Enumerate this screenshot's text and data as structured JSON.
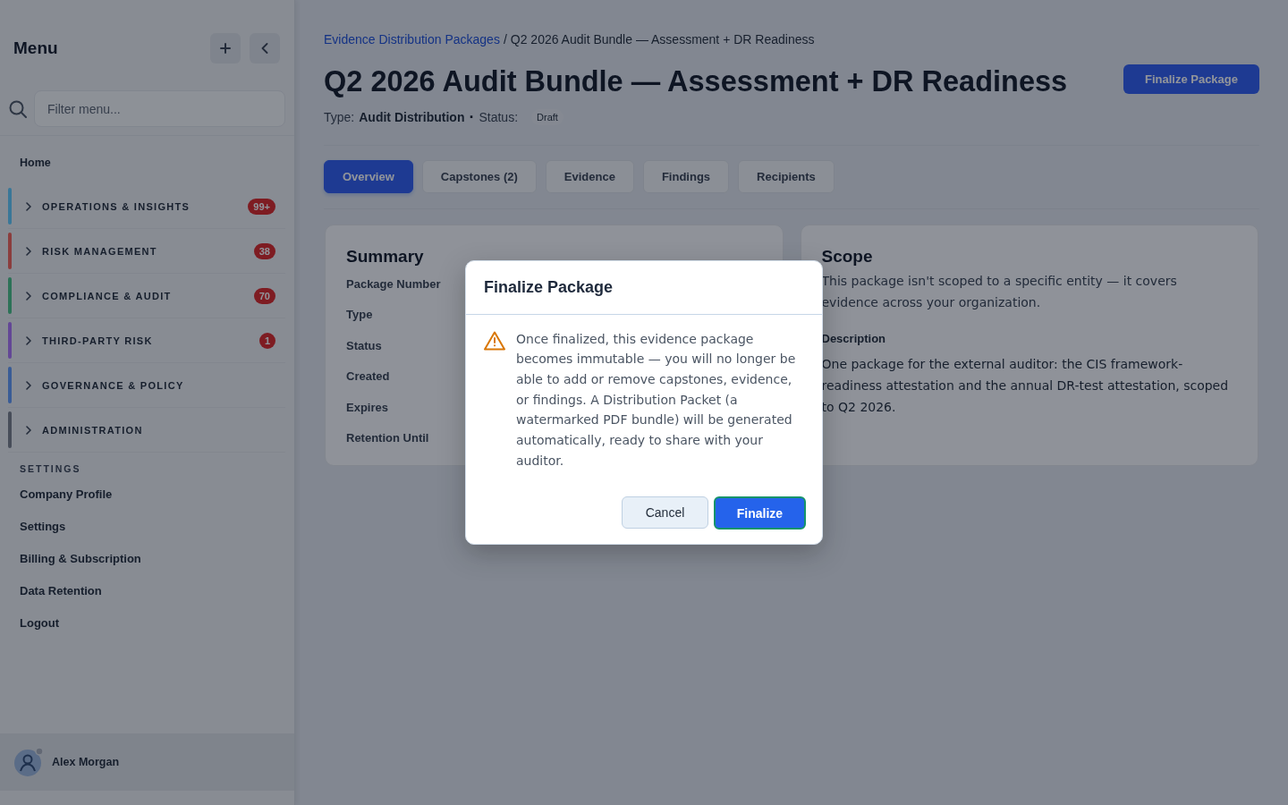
{
  "sidebar": {
    "title": "Menu",
    "filter": {
      "placeholder": "Filter menu..."
    },
    "home": "Home",
    "groups": [
      {
        "label": "OPERATIONS & INSIGHTS",
        "color": "#3a7899",
        "badge": "99+",
        "expanded": false
      },
      {
        "label": "RISK MANAGEMENT",
        "color": "#8c3e3e",
        "badge": "38",
        "expanded": false
      },
      {
        "label": "COMPLIANCE & AUDIT",
        "color": "#2d7358",
        "badge": "70",
        "expanded": false
      },
      {
        "label": "THIRD-PARTY RISK",
        "color": "#644896",
        "badge": "1",
        "expanded": false
      },
      {
        "label": "GOVERNANCE & POLICY",
        "color": "#3a5c96",
        "expanded": false
      },
      {
        "label": "ADMINISTRATION",
        "color": "#484e5a",
        "expanded": false
      }
    ],
    "settings_heading": "SETTINGS",
    "settings_items": [
      "Company Profile",
      "Settings",
      "Billing & Subscription",
      "Data Retention",
      "Logout"
    ],
    "user": {
      "name": "Alex Morgan"
    }
  },
  "breadcrumb": {
    "link": "Evidence Distribution Packages",
    "separator": "/",
    "current": "Q2 2026 Audit Bundle — Assessment + DR Readiness"
  },
  "page": {
    "title": "Q2 2026 Audit Bundle — Assessment + DR Readiness",
    "action": "Finalize Package",
    "meta": {
      "type_label": "Type:",
      "type_value": "Audit Distribution",
      "separator": "·",
      "status_label": "Status:",
      "status_value": "Draft"
    }
  },
  "tabs": [
    {
      "label": "Overview",
      "selected": true
    },
    {
      "label": "Capstones (2)",
      "selected": false
    },
    {
      "label": "Evidence",
      "selected": false
    },
    {
      "label": "Findings",
      "selected": false
    },
    {
      "label": "Recipients",
      "selected": false
    }
  ],
  "summary": {
    "title": "Summary",
    "fields": [
      "Package Number",
      "Type",
      "Status",
      "Created",
      "Expires",
      "Retention Until"
    ]
  },
  "scope": {
    "title": "Scope",
    "text": "This package isn't scoped to a specific entity — it covers evidence across your organization.",
    "description_heading": "Description",
    "description": "One package for the external auditor: the CIS framework-readiness attestation and the annual DR-test attestation, scoped to Q2 2026."
  },
  "dialog": {
    "title": "Finalize Package",
    "message": "Once finalized, this evidence package becomes immutable — you will no longer be able to add or remove capstones, evidence, or findings. A Distribution Packet (a watermarked PDF bundle) will be generated automatically, ready to share with your auditor.",
    "buttons": [
      {
        "label": "Cancel",
        "kind": "secondary",
        "focused": false
      },
      {
        "label": "Finalize",
        "kind": "primary",
        "focused": true
      }
    ]
  }
}
